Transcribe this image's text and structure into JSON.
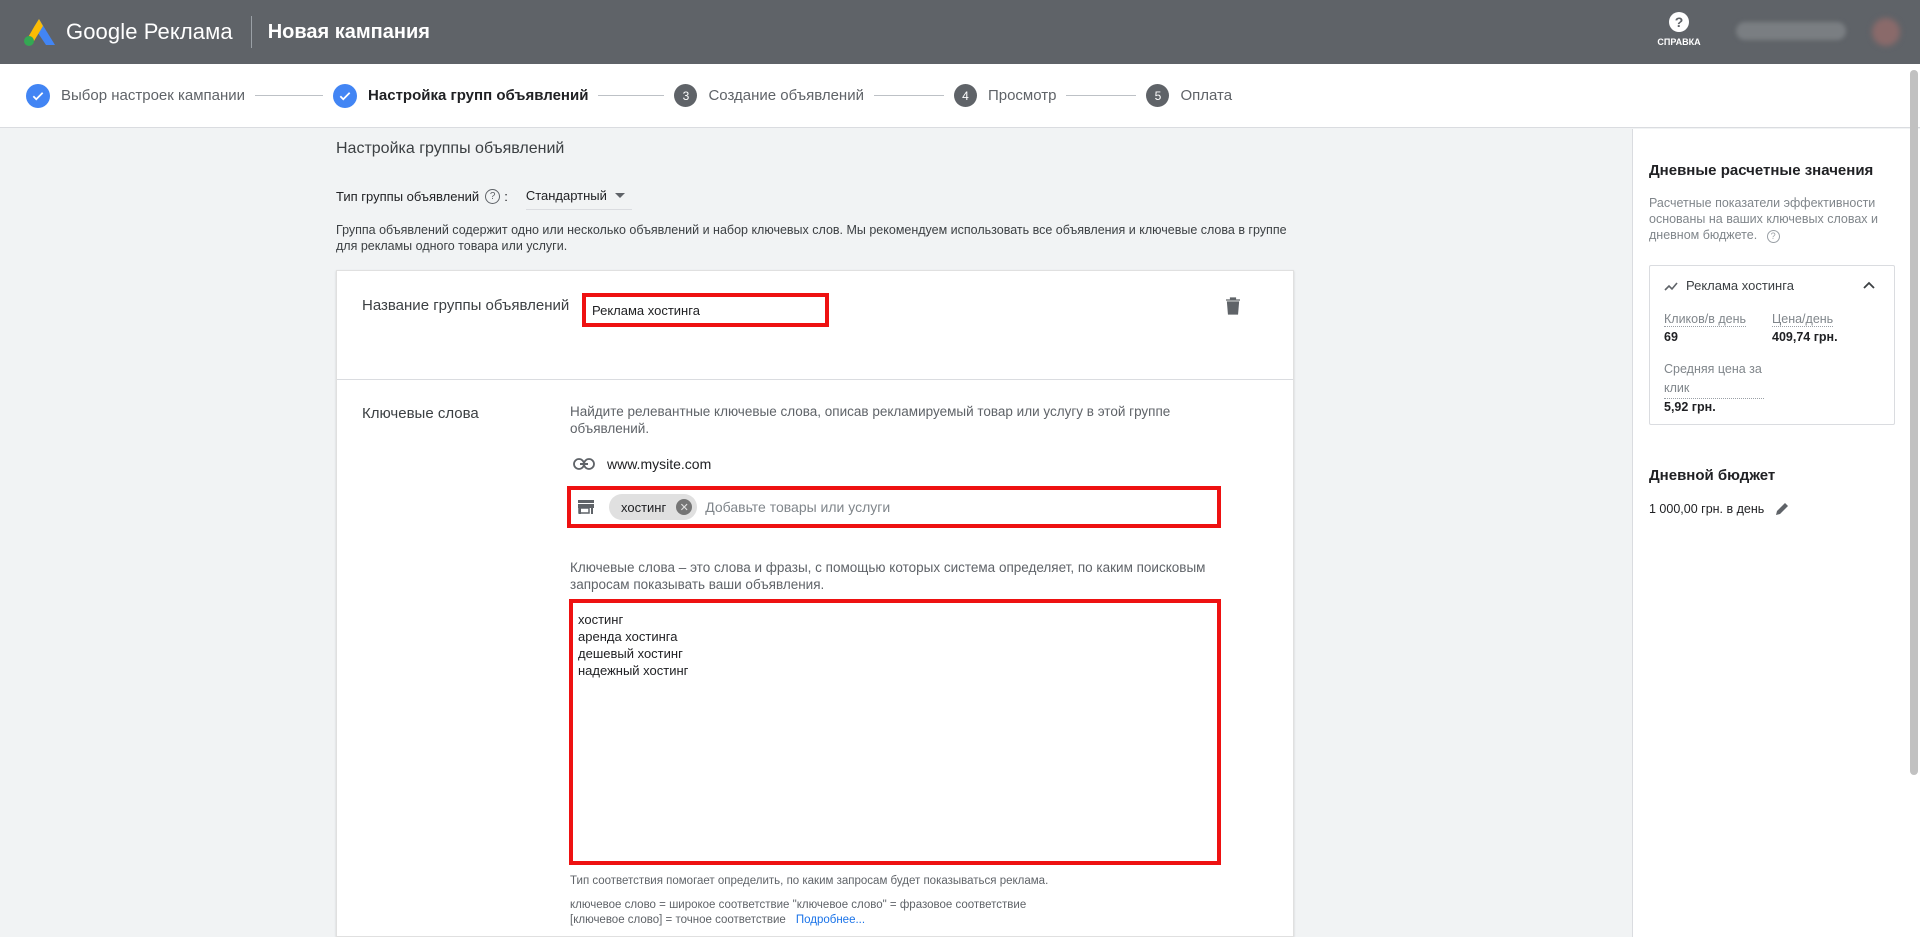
{
  "topbar": {
    "brand": "Google Реклама",
    "campaign_title": "Новая кампания",
    "help_label": "СПРАВКА"
  },
  "stepper": {
    "steps": [
      {
        "label": "Выбор настроек кампании",
        "state": "done"
      },
      {
        "label": "Настройка групп объявлений",
        "state": "active-done"
      },
      {
        "label": "Создание объявлений",
        "number": "3"
      },
      {
        "label": "Просмотр",
        "number": "4"
      },
      {
        "label": "Оплата",
        "number": "5"
      }
    ]
  },
  "main": {
    "section_title": "Настройка группы объявлений",
    "type_label": "Тип группы объявлений",
    "type_colon": ":",
    "type_value": "Стандартный",
    "intro": "Группа объявлений содержит одно или несколько объявлений и набор ключевых слов. Мы рекомендуем использовать все объявления и ключевые слова в группе для рекламы одного товара или услуги.",
    "ad_group_name_label": "Название группы объявлений",
    "ad_group_name_value": "Реклама хостинга",
    "keywords_label": "Ключевые слова",
    "keywords_hint": "Найдите релевантные ключевые слова, описав рекламируемый товар или услугу в этой группе объявлений.",
    "url": "www.mysite.com",
    "product_chip": "хостинг",
    "products_placeholder": "Добавьте товары или услуги",
    "keywords_desc": "Ключевые слова – это слова и фразы, с помощью которых система определяет, по каким поисковым запросам показывать ваши объявления.",
    "keywords_text": "хостинг\nаренда хостинга\nдешевый хостинг\nнадежный хостинг",
    "match_hint": "Тип соответствия помогает определить, по каким запросам будет показываться реклама.",
    "match_example_1": "ключевое слово = широкое соответствие  \"ключевое слово\" = фразовое соответствие",
    "match_example_2": "[ключевое слово] = точное соответствие",
    "more_link": "Подробнее..."
  },
  "rightpanel": {
    "title": "Дневные расчетные значения",
    "desc": "Расчетные показатели эффективности основаны на ваших ключевых словах и дневном бюджете.",
    "card_title": "Реклама хостинга",
    "clicks_label": "Кликов/в день",
    "clicks_value": "69",
    "cost_label": "Цена/день",
    "cost_value": "409,74 грн.",
    "cpc_label": "Средняя цена за клик",
    "cpc_value": "5,92 грн.",
    "budget_title": "Дневной бюджет",
    "budget_value": "1 000,00 грн. в день"
  },
  "colors": {
    "topbar": "#5f6368",
    "accent_blue": "#4285f4",
    "highlight_red": "#ee1111",
    "link": "#1a73e8"
  }
}
